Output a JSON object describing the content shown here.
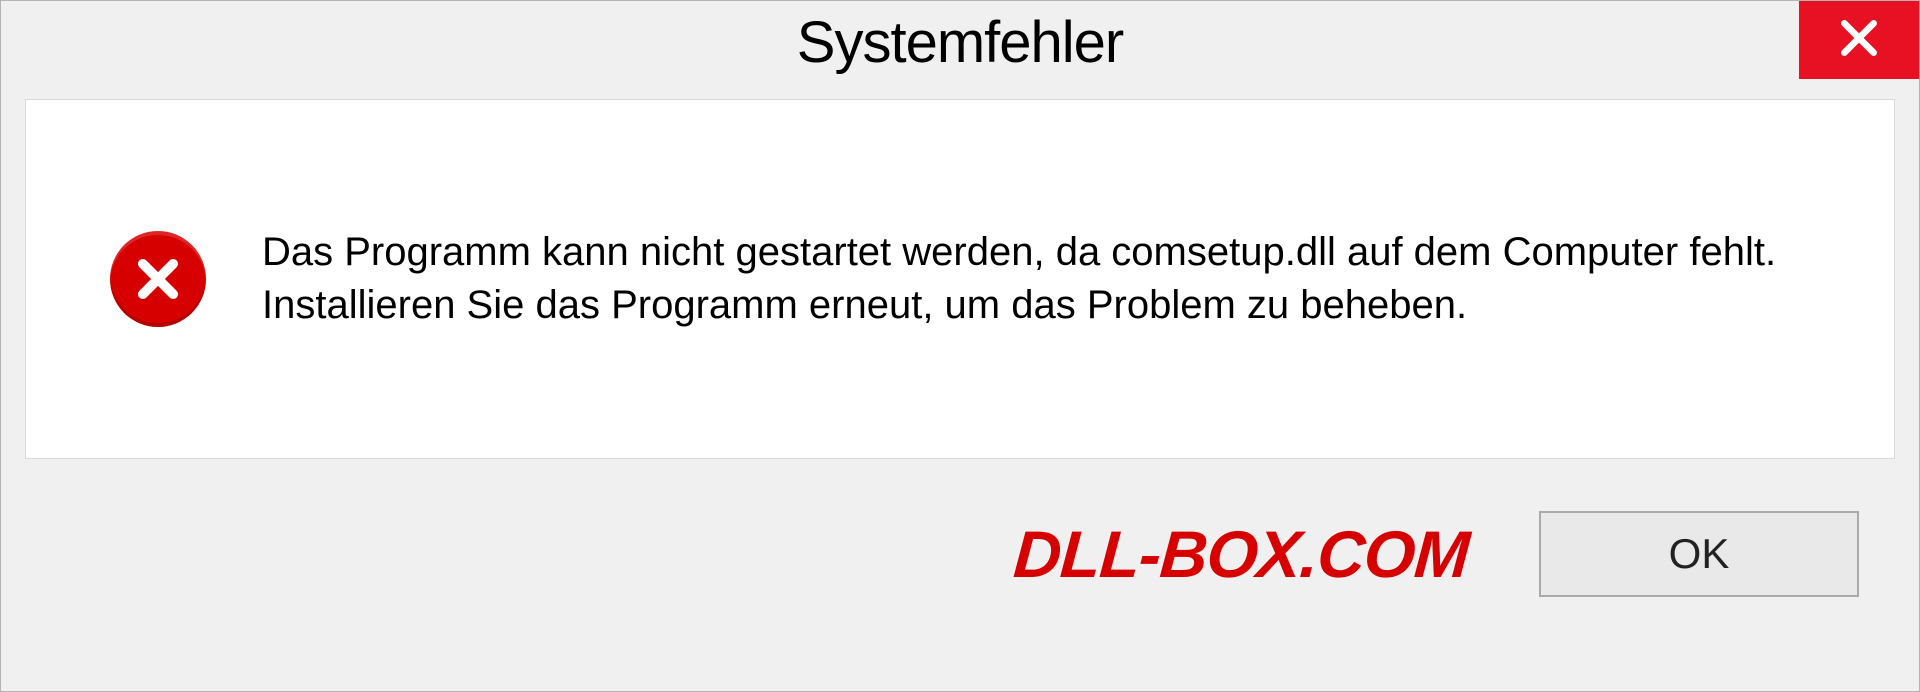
{
  "dialog": {
    "title": "Systemfehler",
    "message": "Das Programm kann nicht gestartet werden, da comsetup.dll auf dem Computer fehlt. Installieren Sie das Programm erneut, um das Problem zu beheben.",
    "ok_label": "OK"
  },
  "watermark": "DLL-BOX.COM",
  "icons": {
    "close": "close-icon",
    "error": "error-icon"
  },
  "colors": {
    "close_bg": "#e81123",
    "error_bg": "#d60000",
    "watermark": "#d60000"
  }
}
